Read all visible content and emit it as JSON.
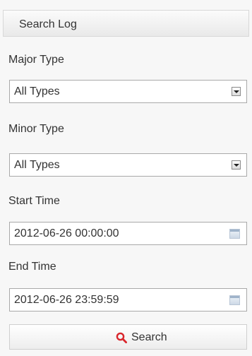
{
  "panel": {
    "title": "Search Log"
  },
  "major_type": {
    "label": "Major Type",
    "selected": "All Types"
  },
  "minor_type": {
    "label": "Minor Type",
    "selected": "All Types"
  },
  "start_time": {
    "label": "Start Time",
    "value": "2012-06-26 00:00:00"
  },
  "end_time": {
    "label": "End Time",
    "value": "2012-06-26 23:59:59"
  },
  "search_button": {
    "label": "Search",
    "icon": "search-icon",
    "icon_color": "#d9262c"
  },
  "colors": {
    "background": "#f7f7f7",
    "border": "#a9a9a9",
    "text": "#333333"
  }
}
